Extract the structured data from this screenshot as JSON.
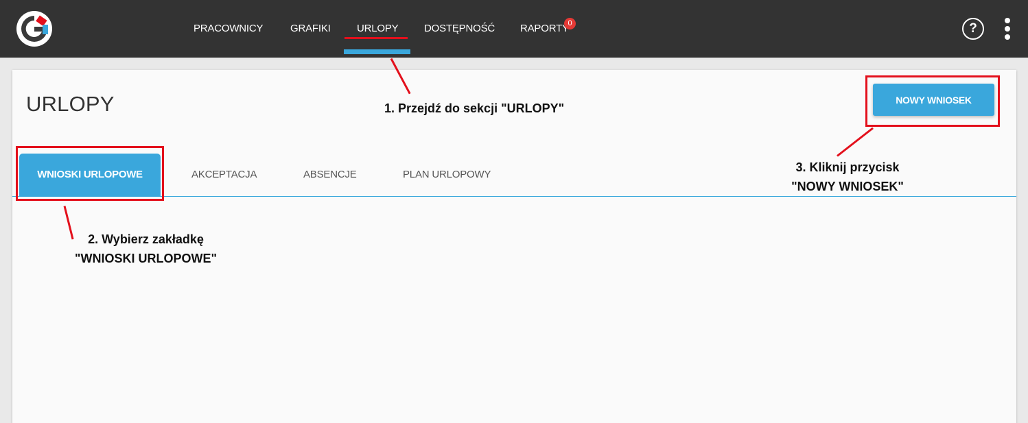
{
  "nav": {
    "items": [
      "PRACOWNICY",
      "GRAFIKI",
      "URLOPY",
      "DOSTĘPNOŚĆ",
      "RAPORTY"
    ],
    "active": "URLOPY",
    "raporty_badge": "0"
  },
  "page": {
    "title": "URLOPY",
    "new_request_button": "NOWY WNIOSEK"
  },
  "tabs": {
    "active": "WNIOSKI URLOPOWE",
    "items": [
      "WNIOSKI URLOPOWE",
      "AKCEPTACJA",
      "ABSENCJE",
      "PLAN URLOPOWY"
    ]
  },
  "annotations": {
    "step1": "1. Przejdź do sekcji \"URLOPY\"",
    "step2_line1": "2. Wybierz zakładkę",
    "step2_line2": "\"WNIOSKI URLOPOWE\"",
    "step3_line1": "3. Kliknij przycisk",
    "step3_line2": "\"NOWY WNIOSEK\""
  },
  "colors": {
    "topbar": "#333333",
    "accent": "#3aa7dc",
    "annotation": "#e3101c",
    "badge": "#e53935"
  },
  "icons": [
    "app-logo-icon",
    "help-icon",
    "more-vertical-icon"
  ]
}
